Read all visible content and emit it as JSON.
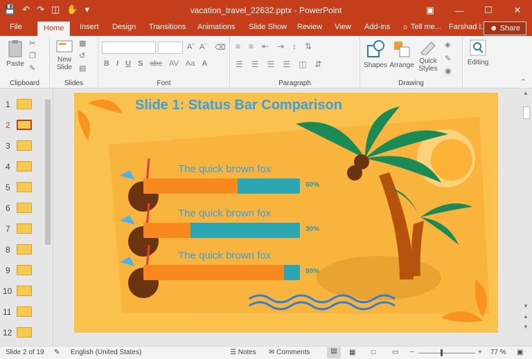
{
  "window": {
    "title": "vacation_travel_22632.pptx - PowerPoint"
  },
  "ribbon_tabs": [
    "File",
    "Home",
    "Insert",
    "Design",
    "Transitions",
    "Animations",
    "Slide Show",
    "Review",
    "View",
    "Add-ins"
  ],
  "tell_me": "Tell me...",
  "user": "Farshad I...",
  "share": "Share",
  "groups": {
    "clipboard": "Clipboard",
    "slides": "Slides",
    "font": "Font",
    "paragraph": "Paragraph",
    "drawing": "Drawing"
  },
  "buttons": {
    "paste": "Paste",
    "new_slide_1": "New",
    "new_slide_2": "Slide",
    "shapes": "Shapes",
    "arrange": "Arrange",
    "quick_styles_1": "Quick",
    "quick_styles_2": "Styles",
    "editing": "Editing"
  },
  "font_buttons": [
    "B",
    "I",
    "U",
    "S",
    "abc",
    "AV",
    "Aa",
    "A"
  ],
  "thumbnails": [
    "1",
    "2",
    "3",
    "4",
    "5",
    "6",
    "7",
    "8",
    "9",
    "10",
    "11",
    "12"
  ],
  "selected_slide": "2",
  "slide": {
    "title": "Slide 1: Status Bar Comparison",
    "bars": [
      {
        "label": "The quick brown fox",
        "value": 60,
        "text": "60%"
      },
      {
        "label": "The quick brown fox",
        "value": 30,
        "text": "30%"
      },
      {
        "label": "The quick brown fox",
        "value": 90,
        "text": "90%"
      }
    ],
    "colors": {
      "background": "#fbc14d",
      "title": "#3aa0e0",
      "fill": "#f7891e",
      "track": "#2aa7b3",
      "label": "#3aa0e0",
      "percent": "#2a9aa5"
    }
  },
  "status": {
    "slide_of": "Slide 2 of 19",
    "language": "English (United States)",
    "notes": "Notes",
    "comments": "Comments",
    "zoom": "77 %"
  }
}
